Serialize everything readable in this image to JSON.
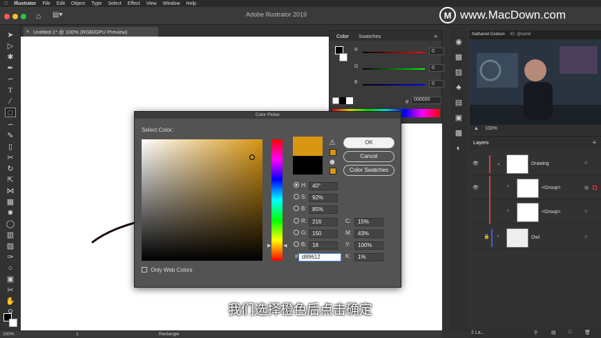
{
  "menubar": {
    "app": "Illustrator",
    "items": [
      "File",
      "Edit",
      "Object",
      "Type",
      "Select",
      "Effect",
      "View",
      "Window",
      "Help"
    ]
  },
  "app_title": "Adobe Illustrator 2019",
  "watermark": "www.MacDown.com",
  "document_tab": "Untitled-1* @ 100% (RGB/GPU Preview)",
  "color_panel": {
    "tabs": [
      "Color",
      "Swatches"
    ],
    "rows": [
      {
        "label": "R",
        "value": "0"
      },
      {
        "label": "G",
        "value": "0"
      },
      {
        "label": "B",
        "value": "0"
      }
    ],
    "hex_prefix": "#",
    "hex": "000000"
  },
  "webcam": {
    "name": "Nathaniel Dodson",
    "handle": "IG: @tutvid",
    "zoom": "100%"
  },
  "layers": {
    "title": "Layers",
    "rows": [
      "Drawing",
      "<Group>",
      "<Group>",
      "Owl"
    ],
    "footer": "2 La..."
  },
  "dialog": {
    "title": "Color Picker",
    "select_label": "Select Color:",
    "buttons": {
      "ok": "OK",
      "cancel": "Cancel",
      "swatches": "Color Swatches"
    },
    "only_web": "Only Web Colors",
    "new_color": "#d89612",
    "fields": {
      "H": "40°",
      "S": "92%",
      "B": "85%",
      "R": "216",
      "G": "150",
      "B2": "18",
      "C": "15%",
      "M": "43%",
      "Y": "100%",
      "K": "1%"
    },
    "hex_prefix": "#",
    "hex": "d89612"
  },
  "status": {
    "zoom": "100%",
    "page": "1",
    "tool": "Rectangle"
  },
  "subtitle": "我们选择橙色后点击确定"
}
